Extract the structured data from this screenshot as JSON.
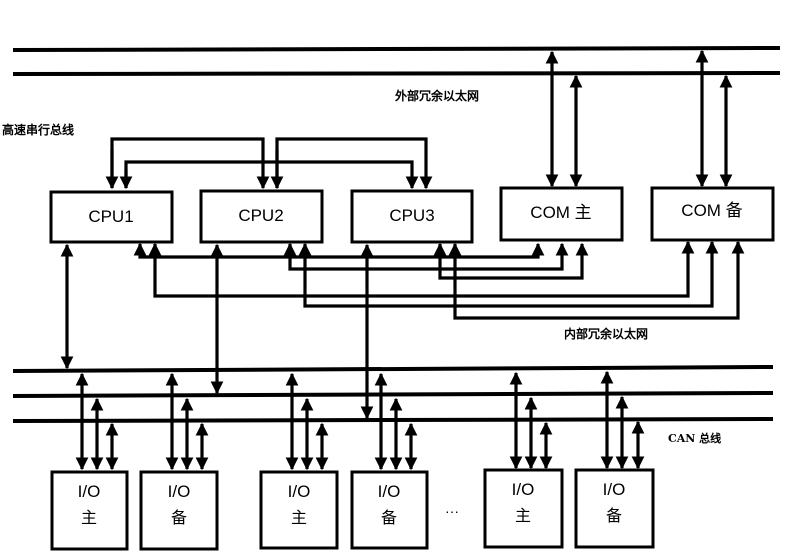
{
  "diagram": {
    "labels": {
      "external_ethernet": "外部冗余以太网",
      "high_speed_serial_bus": "高速串行总线",
      "internal_ethernet": "内部冗余以太网",
      "can_bus": "CAN 总线",
      "ellipsis": "···"
    },
    "top_modules": [
      {
        "id": "cpu1",
        "label": "CPU1"
      },
      {
        "id": "cpu2",
        "label": "CPU2"
      },
      {
        "id": "cpu3",
        "label": "CPU3"
      },
      {
        "id": "com-main",
        "label": "COM 主"
      },
      {
        "id": "com-backup",
        "label": "COM 备"
      }
    ],
    "io_modules": [
      {
        "line1": "I/O",
        "line2": "主"
      },
      {
        "line1": "I/O",
        "line2": "备"
      },
      {
        "line1": "I/O",
        "line2": "主"
      },
      {
        "line1": "I/O",
        "line2": "备"
      },
      {
        "line1": "I/O",
        "line2": "主"
      },
      {
        "line1": "I/O",
        "line2": "备"
      }
    ],
    "connections": {
      "external_ethernet": [
        "COM 主",
        "COM 备"
      ],
      "high_speed_serial_bus": [
        "CPU1",
        "CPU2",
        "CPU3"
      ],
      "internal_ethernet": [
        "CPU1",
        "CPU2",
        "CPU3",
        "COM 主",
        "COM 备"
      ],
      "can_bus": [
        "CPU1",
        "CPU2",
        "CPU3",
        "I/O 主",
        "I/O 备"
      ]
    }
  }
}
